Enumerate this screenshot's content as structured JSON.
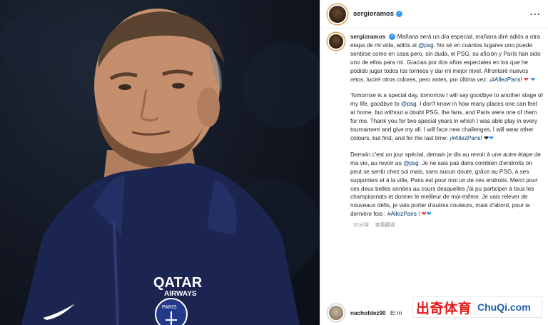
{
  "post": {
    "username": "sergioramos",
    "more_icon": "more-horizontal-icon",
    "verified_icon": "verified-badge-icon",
    "caption": {
      "es_1": "Mañana será un día especial, mañana diré adiós a otra etapa de mi vida, adiós al",
      "es_mention": "@psg",
      "es_2": "No sé en cuántos lugares uno puede sentirse como en casa pero, sin duda, el PSG, su afición y París han sido uno de ellos para mí. Gracias por dos años especiales en los que he podido jugar todos los torneos y dar mi mejor nivel. Afrontaré nuevos retos, luciré otros colores, pero antes, por última vez:",
      "es_tag": "¡#AllezParis!",
      "en_1": "Tomorrow is a special day, tomorrow I will say goodbye to another stage of my life, goodbye to",
      "en_mention": "@psg",
      "en_2": "I don't know in how many places one can feel at home, but without a doubt PSG, the fans, and Paris were one of them for me. Thank you for two special years in which I was able play in every tournament and give my all. I will face new challenges, I will wear other colours, but first, and for the last time:",
      "en_tag": "¡#AllezParis!",
      "fr_1": "Demain c'est un jour spécial, demain je dis au revoir à une autre étape de ma vie, au revoir au",
      "fr_mention": "@psg",
      "fr_2": "Je ne sais pas dans combien d'endroits on peut se sentir chez soi mais, sans aucun doute, grâce au PSG, à ses supporters et à la ville, Paris est pour moi un de ces endroits. Merci pour ces deux belles années au cours desquelles j'ai pu participer à tous les championnats et donner le meilleur de moi-même. Je vais relever de nouveaux défis, je vais porter d'autres couleurs, mais d'abord, pour la dernière fois :",
      "fr_tag": "#AllezParis !",
      "time": "32分钟",
      "translate": "查看翻译"
    },
    "comment": {
      "username": "nachofdez90",
      "text": "El m"
    }
  },
  "watermark": {
    "cn": "出奇体育",
    "en": "ChuQi.com"
  },
  "colors": {
    "link": "#00376b",
    "heart_red": "#ed4956",
    "heart_blue": "#3897f0",
    "verified": "#3897f0",
    "jersey": "#1b2550"
  },
  "photo": {
    "sponsor_line1": "QATAR",
    "sponsor_line2": "AIRWAYS",
    "crest_text": "PARIS"
  }
}
